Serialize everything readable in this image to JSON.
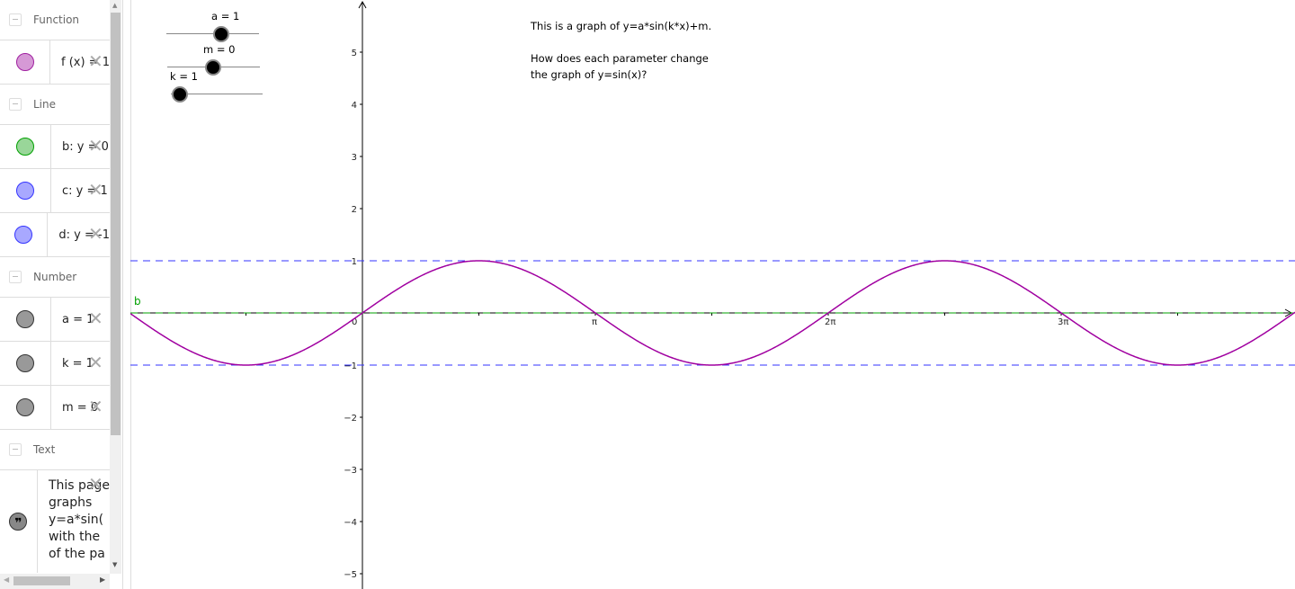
{
  "algebra": {
    "categories": [
      {
        "label": "Function",
        "items": [
          {
            "text": "f (x) = 1",
            "color": "#d699d6",
            "border": "#a020a0"
          }
        ]
      },
      {
        "label": "Line",
        "items": [
          {
            "text": "b: y = 0",
            "color": "#99d699",
            "border": "#00a000"
          },
          {
            "text": "c: y = 1",
            "color": "#a8a8ff",
            "border": "#3333ff"
          },
          {
            "text": "d: y = -1",
            "color": "#a8a8ff",
            "border": "#3333ff"
          }
        ]
      },
      {
        "label": "Number",
        "items": [
          {
            "text": "a = 1",
            "color": "#999999",
            "border": "#333333"
          },
          {
            "text": "k = 1",
            "color": "#999999",
            "border": "#333333"
          },
          {
            "text": "m = 0",
            "color": "#999999",
            "border": "#333333"
          }
        ]
      },
      {
        "label": "Text",
        "items": [
          {
            "lines": [
              "This page",
              "graphs",
              "y=a*sin(",
              "with the",
              "of the pa"
            ]
          }
        ]
      }
    ]
  },
  "sliders": [
    {
      "label": "a = 1",
      "value": 1
    },
    {
      "label": "m = 0",
      "value": 0
    },
    {
      "label": "k = 1",
      "value": 1
    }
  ],
  "description": {
    "line1": "This is a graph of y=a*sin(k*x)+m.",
    "line2": "How does each parameter change",
    "line3": "the graph of y=sin(x)?"
  },
  "chart_data": {
    "type": "line",
    "function": "y=a*sin(k*x)+m",
    "a": 1,
    "k": 1,
    "m": 0,
    "xlim": [
      "-π",
      "4π"
    ],
    "ylim": [
      -5.2,
      5.9
    ],
    "x_tick_labels": [
      "0",
      "π",
      "2π",
      "3π"
    ],
    "y_tick_labels": [
      "5",
      "4",
      "3",
      "2",
      "1",
      "−1",
      "−2",
      "−3",
      "−4",
      "−5"
    ],
    "lines": [
      {
        "name": "b",
        "y": 0,
        "color": "#00a000"
      },
      {
        "name": "c",
        "y": 1,
        "color": "#3333ff"
      },
      {
        "name": "d",
        "y": -1,
        "color": "#3333ff"
      }
    ],
    "curve_color": "#a000a0"
  }
}
